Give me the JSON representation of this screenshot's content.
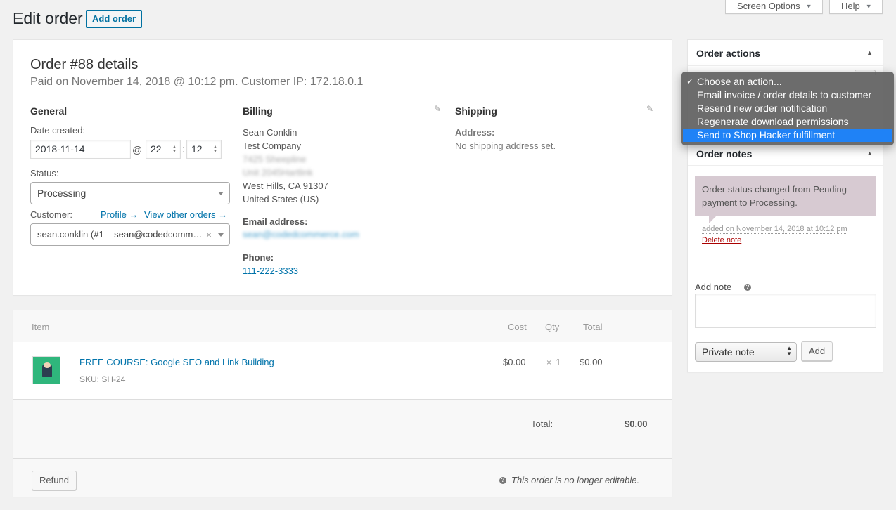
{
  "header": {
    "page_title": "Edit order",
    "add_order_label": "Add order",
    "screen_options_label": "Screen Options",
    "help_label": "Help",
    "triangle": "▼"
  },
  "order": {
    "heading": "Order #88 details",
    "subheading": "Paid on November 14, 2018 @ 10:12 pm. Customer IP: 172.18.0.1",
    "general": {
      "title": "General",
      "date_created_label": "Date created:",
      "date_value": "2018-11-14",
      "at_symbol": "@",
      "hour": "22",
      "colon": ":",
      "minute": "12",
      "status_label": "Status:",
      "status_value": "Processing",
      "customer_label": "Customer:",
      "profile_link": "Profile →",
      "view_other_orders_link": "View other orders →",
      "customer_value": "sean.conklin (#1 – sean@codedcomm…",
      "clear_symbol": "×"
    },
    "billing": {
      "title": "Billing",
      "name": "Sean Conklin",
      "company": "Test Company",
      "address_line_1": "7425 Sheepline",
      "address_line_2": "Unit 2045Hartlink",
      "city_line": "West Hills, CA 91307",
      "country": "United States (US)",
      "email_label": "Email address:",
      "email_value": "sean@codedcommerce.com",
      "phone_label": "Phone:",
      "phone_value": "111-222-3333"
    },
    "shipping": {
      "title": "Shipping",
      "address_label": "Address:",
      "address_value": "No shipping address set."
    }
  },
  "items": {
    "columns": {
      "item": "Item",
      "cost": "Cost",
      "qty": "Qty",
      "total": "Total"
    },
    "rows": [
      {
        "name": "FREE COURSE: Google SEO and Link Building",
        "sku_label": "SKU:",
        "sku": "SH-24",
        "cost": "$0.00",
        "qty_prefix": "×",
        "qty": "1",
        "total": "$0.00"
      }
    ],
    "total_label": "Total:",
    "total_value": "$0.00",
    "refund_label": "Refund",
    "not_editable_text": "This order is no longer editable.",
    "help_icon_glyph": "?"
  },
  "sidebar": {
    "order_actions": {
      "title": "Order actions",
      "toggle": "▲",
      "menu": [
        {
          "label": "Choose an action...",
          "checked": true,
          "highlighted": false
        },
        {
          "label": "Email invoice / order details to customer",
          "checked": false,
          "highlighted": false
        },
        {
          "label": "Resend new order notification",
          "checked": false,
          "highlighted": false
        },
        {
          "label": "Regenerate download permissions",
          "checked": false,
          "highlighted": false
        },
        {
          "label": "Send to Shop Hacker fulfillment",
          "checked": false,
          "highlighted": true
        }
      ],
      "check_glyph": "✓"
    },
    "order_notes": {
      "title": "Order notes",
      "toggle": "▲",
      "notes": [
        {
          "text": "Order status changed from Pending payment to Processing.",
          "meta": "added on November 14, 2018 at 10:12 pm",
          "delete_label": "Delete note"
        }
      ],
      "add_note_label": "Add note",
      "add_note_value": "",
      "note_type_value": "Private note",
      "add_button_label": "Add"
    }
  },
  "colors": {
    "accent": "#0073aa",
    "note_bg": "#d7cad2",
    "menu_highlight": "#1f82f6",
    "delete": "#a00000",
    "product_thumb": "#2fb67c"
  }
}
